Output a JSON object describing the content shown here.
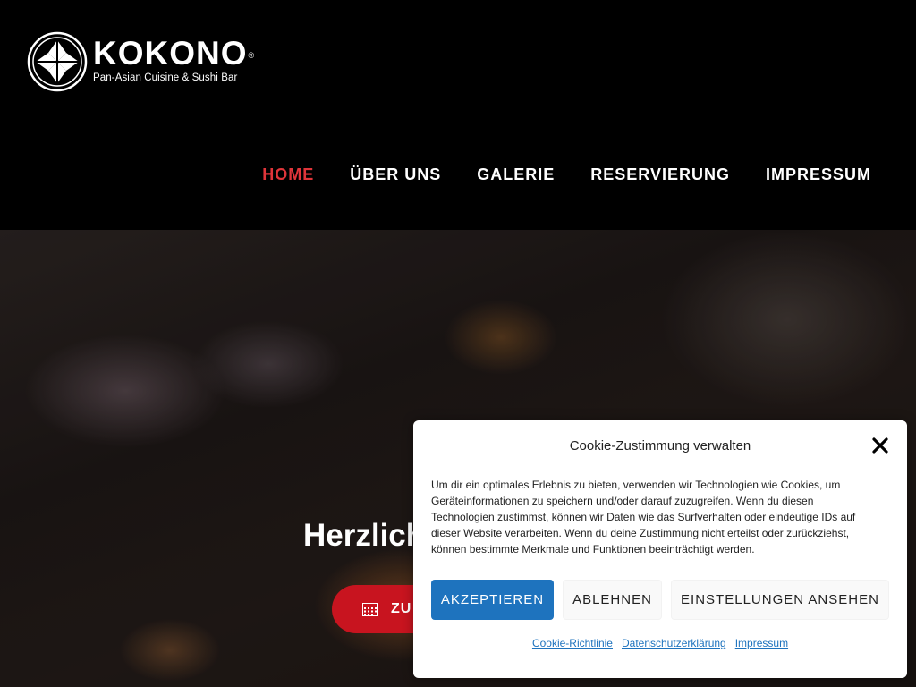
{
  "brand": {
    "name": "KOKONO",
    "registered": "®",
    "tagline": "Pan-Asian Cuisine & Sushi Bar"
  },
  "nav": {
    "items": [
      {
        "label": "HOME",
        "active": true
      },
      {
        "label": "ÜBER UNS",
        "active": false
      },
      {
        "label": "GALERIE",
        "active": false
      },
      {
        "label": "RESERVIERUNG",
        "active": false
      },
      {
        "label": "IMPRESSUM",
        "active": false
      }
    ]
  },
  "hero": {
    "title": "Herzlich",
    "button_label": "ZU"
  },
  "cookie": {
    "title": "Cookie-Zustimmung verwalten",
    "text": "Um dir ein optimales Erlebnis zu bieten, verwenden wir Technologien wie Cookies, um Geräteinformationen zu speichern und/oder darauf zuzugreifen. Wenn du diesen Technologien zustimmst, können wir Daten wie das Surfverhalten oder eindeutige IDs auf dieser Website verarbeiten. Wenn du deine Zustimmung nicht erteilst oder zurückziehst, können bestimmte Merkmale und Funktionen beeinträchtigt werden.",
    "accept_label": "AKZEPTIEREN",
    "deny_label": "ABLEHNEN",
    "prefs_label": "EINSTELLUNGEN ANSEHEN",
    "links": [
      "Cookie-Richtlinie",
      "Datenschutzerklärung",
      "Impressum"
    ]
  },
  "colors": {
    "accent": "#e0353a",
    "button_red": "#c8141f",
    "accept_blue": "#1e73be"
  }
}
